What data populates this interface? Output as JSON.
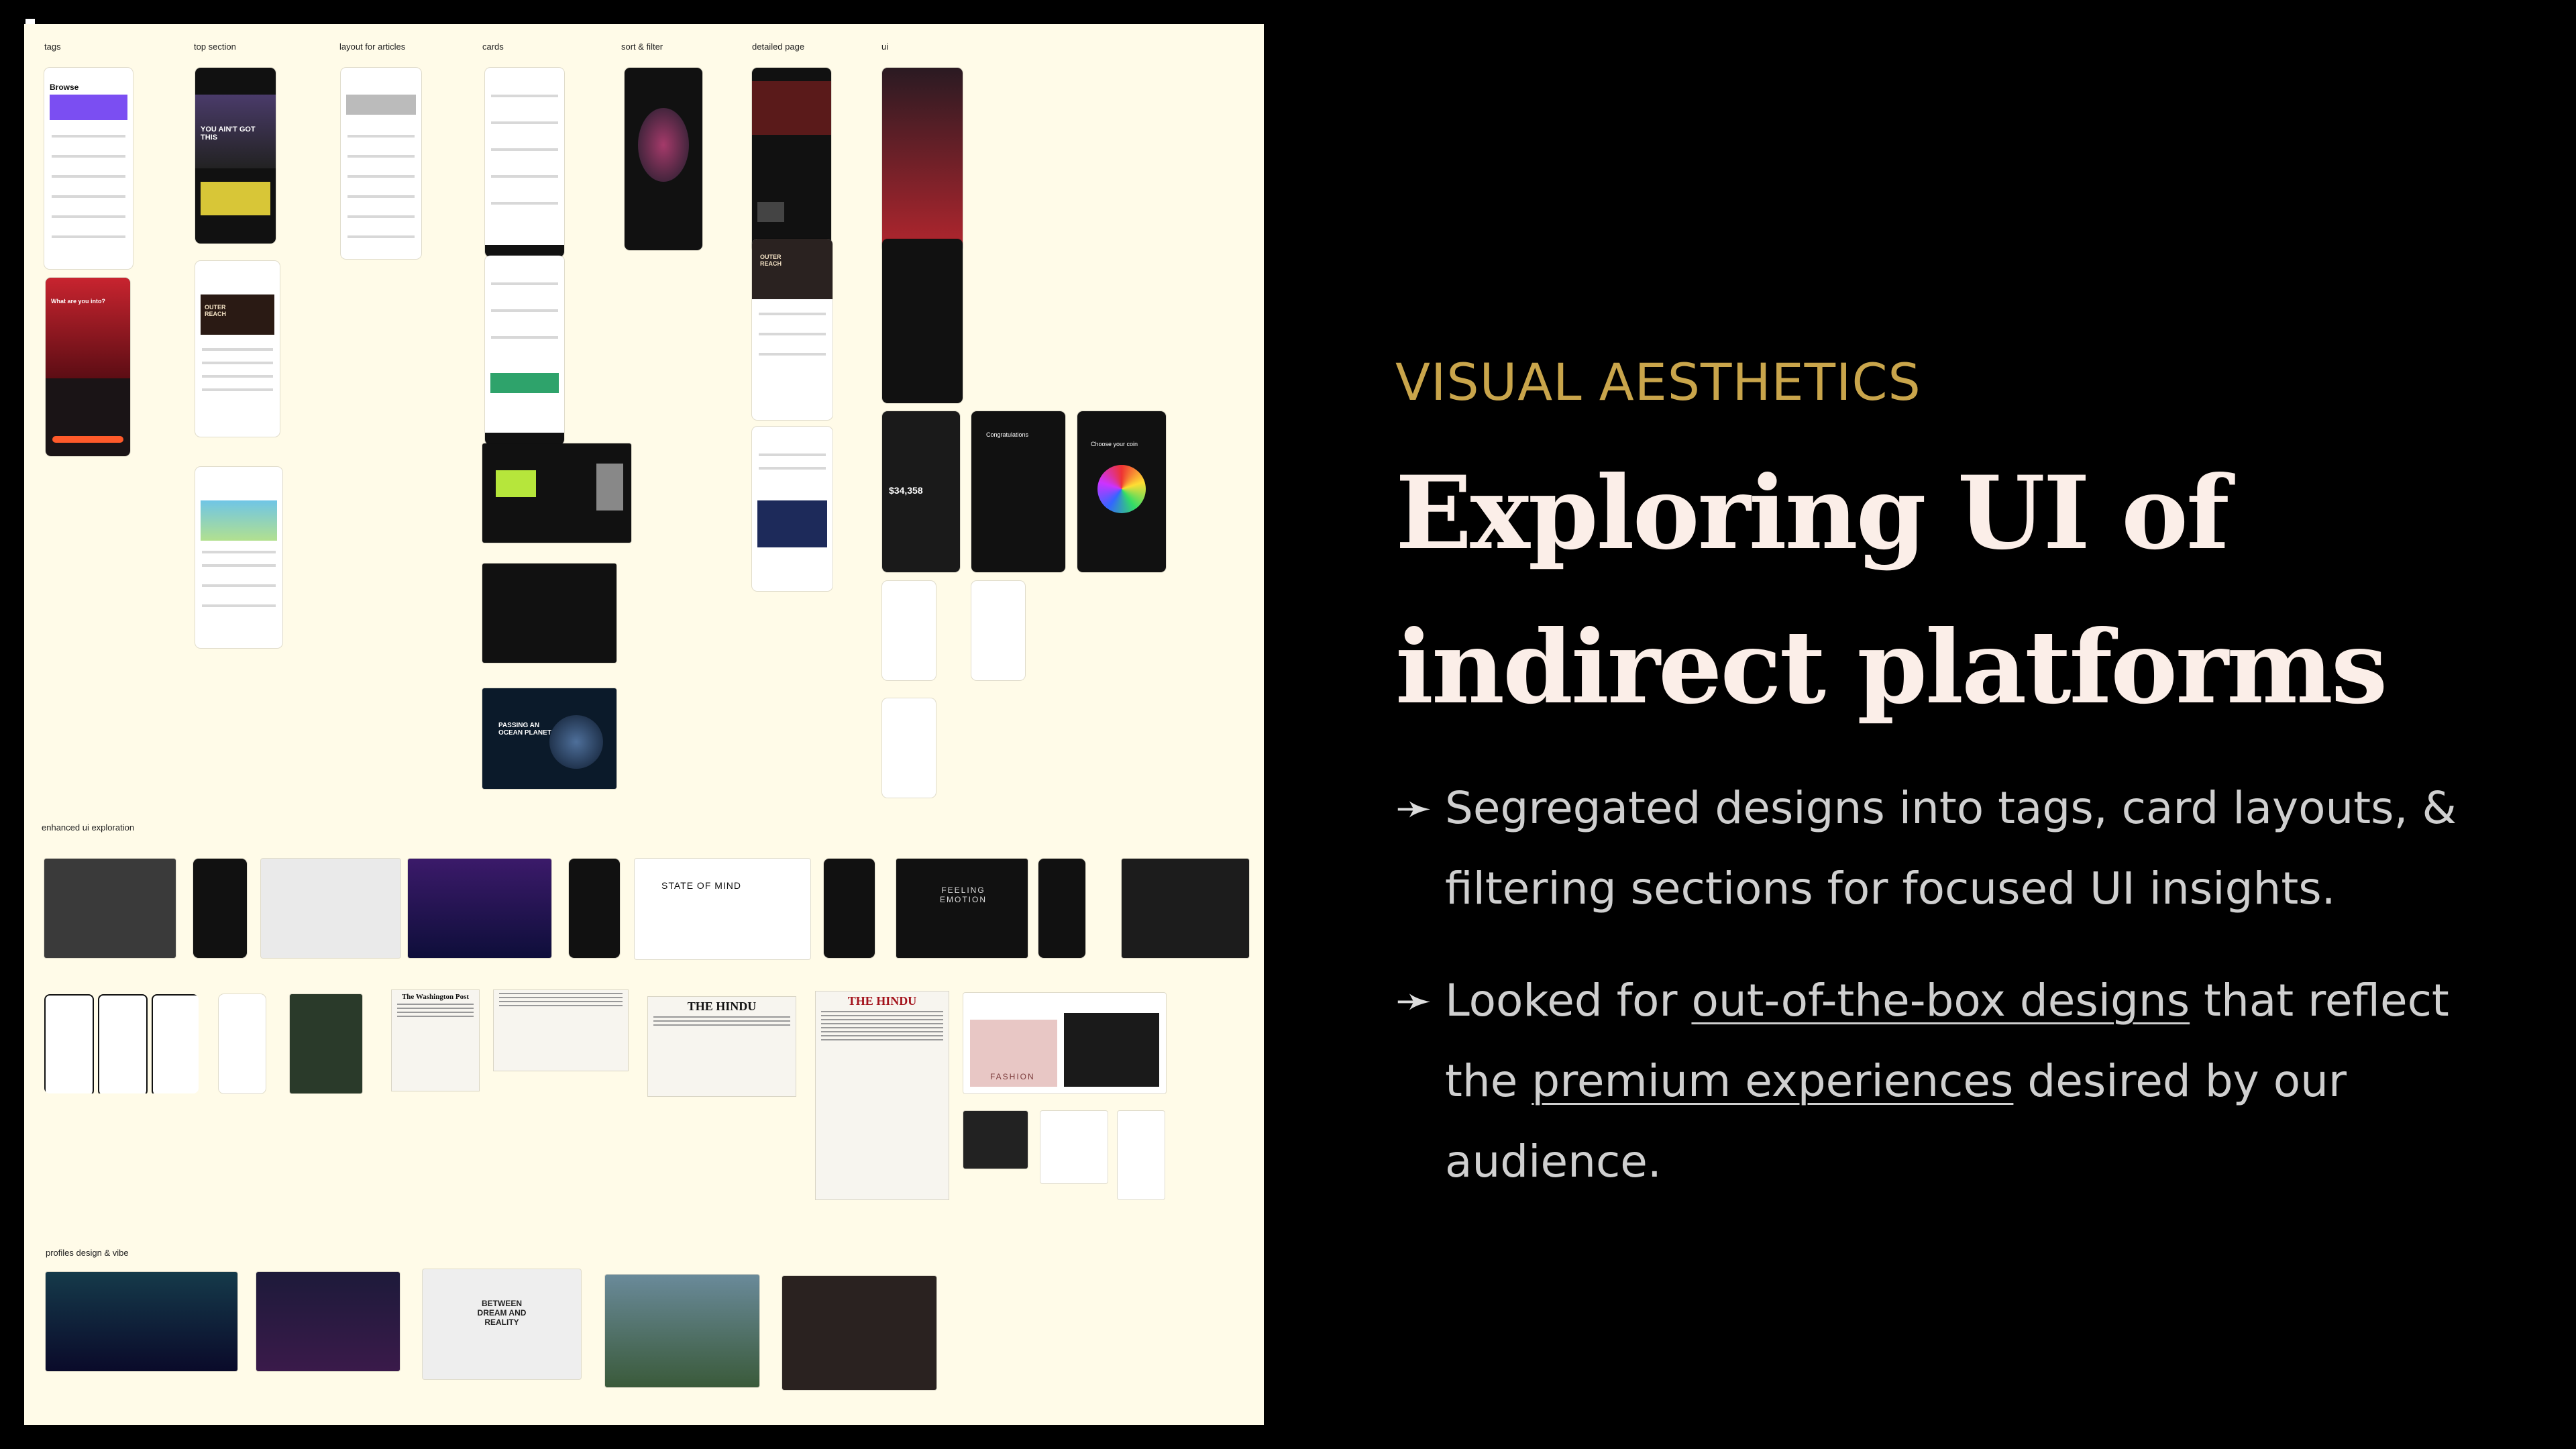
{
  "board": {
    "section_labels": {
      "tags": "tags",
      "top_section": "top section",
      "layout_for_articles": "layout for articles",
      "cards": "cards",
      "sort_filter": "sort & filter",
      "detailed_page": "detailed page",
      "ui": "ui",
      "enhanced": "enhanced ui exploration",
      "profiles": "profiles design & vibe"
    },
    "thumb_text": {
      "browse": "Browse",
      "what_are_you_into": "What are you into?",
      "you_aint_got_this": "YOU AIN'T GOT THIS",
      "outer_reach": "OUTER REACH",
      "state_of_mind": "STATE OF MIND",
      "feeling_emotion": "FEELING EMOTION",
      "washington_post": "The Washington Post",
      "the_hindu": "THE HINDU",
      "fashion": "FASHION",
      "between_dream_reality": "BETWEEN DREAM AND REALITY",
      "passing_an_ocean_planet": "PASSING AN OCEAN PLANET",
      "amount": "$34,358",
      "congratulations": "Congratulations",
      "choose_your_coin": "Choose your coin"
    }
  },
  "slide": {
    "eyebrow": "VISUAL AESTHETICS",
    "title_line1": "Exploring UI of",
    "title_line2": "indirect platforms",
    "bullet_arrow": "➛",
    "bullet1": "Segregated designs into tags, card layouts, & filtering sections for focused UI insights.",
    "bullet2_pre": "Looked for ",
    "bullet2_link1": "out-of-the-box designs",
    "bullet2_mid": " that reflect the ",
    "bullet2_link2": "premium experiences",
    "bullet2_post": " desired by our audience."
  },
  "colors": {
    "background": "#000000",
    "board": "#fffbe8",
    "eyebrow": "#c9a54b",
    "title": "#fbeee8",
    "body": "#cfcfcf"
  }
}
